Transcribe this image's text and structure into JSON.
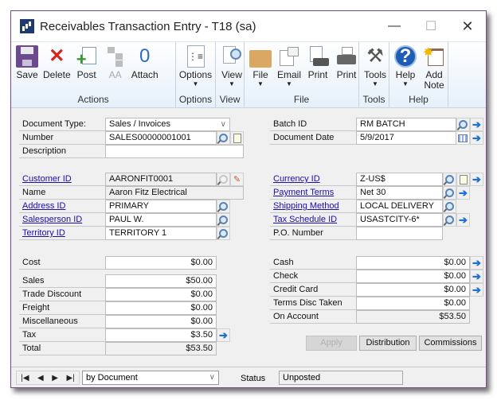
{
  "window": {
    "title": "Receivables Transaction Entry  -  T18 (sa)",
    "controls": {
      "minimize": "—",
      "maximize": "☐",
      "close": "✕"
    }
  },
  "ribbon": {
    "groups": [
      {
        "label": "Actions",
        "buttons": [
          {
            "label": "Save",
            "icon": "save-icon"
          },
          {
            "label": "Delete",
            "icon": "delete-icon"
          },
          {
            "label": "Post",
            "icon": "post-icon"
          },
          {
            "label": "AA",
            "icon": "aa-icon",
            "disabled": true
          },
          {
            "label": "Attach",
            "icon": "paperclip-icon"
          }
        ]
      },
      {
        "label": "Options",
        "buttons": [
          {
            "label": "Options",
            "icon": "options-icon",
            "dropdown": true
          }
        ]
      },
      {
        "label": "View",
        "buttons": [
          {
            "label": "View",
            "icon": "view-icon",
            "dropdown": true
          }
        ]
      },
      {
        "label": "File",
        "buttons": [
          {
            "label": "File",
            "icon": "folder-icon",
            "dropdown": true
          },
          {
            "label": "Email",
            "icon": "email-icon",
            "dropdown": true
          },
          {
            "label": "Print",
            "icon": "print-document-icon"
          },
          {
            "label": "Print",
            "icon": "printer-icon"
          }
        ]
      },
      {
        "label": "Tools",
        "buttons": [
          {
            "label": "Tools",
            "icon": "tools-icon",
            "dropdown": true
          }
        ]
      },
      {
        "label": "Help",
        "buttons": [
          {
            "label": "Help",
            "icon": "help-icon",
            "dropdown": true
          },
          {
            "label": "Add Note",
            "icon": "add-note-icon"
          }
        ]
      }
    ],
    "caret": "▼",
    "delete_glyph": "✕",
    "attach_glyph": "0",
    "tools_glyph": "⚒",
    "help_glyph": "?",
    "note_star": "✸",
    "post_plus": "+"
  },
  "header_left": {
    "document_type": {
      "label": "Document Type:",
      "value": "Sales / Invoices"
    },
    "number": {
      "label": "Number",
      "value": "SALES00000001001"
    },
    "description": {
      "label": "Description",
      "value": ""
    }
  },
  "header_right": {
    "batch_id": {
      "label": "Batch ID",
      "value": "RM BATCH"
    },
    "document_date": {
      "label": "Document Date",
      "value": "5/9/2017"
    }
  },
  "customer": {
    "customer_id": {
      "label": "Customer ID",
      "value": "AARONFIT0001"
    },
    "name": {
      "label": "Name",
      "value": "Aaron Fitz Electrical"
    },
    "address_id": {
      "label": "Address ID",
      "value": "PRIMARY"
    },
    "salesperson_id": {
      "label": "Salesperson ID",
      "value": "PAUL W."
    },
    "territory_id": {
      "label": "Territory ID",
      "value": "TERRITORY 1"
    }
  },
  "terms": {
    "currency_id": {
      "label": "Currency ID",
      "value": "Z-US$"
    },
    "payment_terms": {
      "label": "Payment Terms",
      "value": "Net 30"
    },
    "shipping_method": {
      "label": "Shipping Method",
      "value": "LOCAL DELIVERY"
    },
    "tax_schedule_id": {
      "label": "Tax Schedule ID",
      "value": "USASTCITY-6*"
    },
    "po_number": {
      "label": "P.O. Number",
      "value": ""
    }
  },
  "amounts": {
    "cost": {
      "label": "Cost",
      "value": "$0.00"
    },
    "sales": {
      "label": "Sales",
      "value": "$50.00"
    },
    "trade_discount": {
      "label": "Trade Discount",
      "value": "$0.00"
    },
    "freight": {
      "label": "Freight",
      "value": "$0.00"
    },
    "miscellaneous": {
      "label": "Miscellaneous",
      "value": "$0.00"
    },
    "tax": {
      "label": "Tax",
      "value": "$3.50"
    },
    "total": {
      "label": "Total",
      "value": "$53.50"
    }
  },
  "payments": {
    "cash": {
      "label": "Cash",
      "value": "$0.00"
    },
    "check": {
      "label": "Check",
      "value": "$0.00"
    },
    "credit_card": {
      "label": "Credit Card",
      "value": "$0.00"
    },
    "terms_disc_taken": {
      "label": "Terms Disc Taken",
      "value": "$0.00"
    },
    "on_account": {
      "label": "On Account",
      "value": "$53.50"
    }
  },
  "actions": {
    "apply": "Apply",
    "distribution": "Distribution",
    "commissions": "Commissions"
  },
  "statusbar": {
    "nav": {
      "first": "|◀",
      "prev": "◀",
      "next": "▶",
      "last": "▶|"
    },
    "sort_by": "by Document",
    "status_label": "Status",
    "status_value": "Unposted"
  },
  "glyphs": {
    "arrow": "➔",
    "chevron": "∨",
    "edit": "✎"
  }
}
